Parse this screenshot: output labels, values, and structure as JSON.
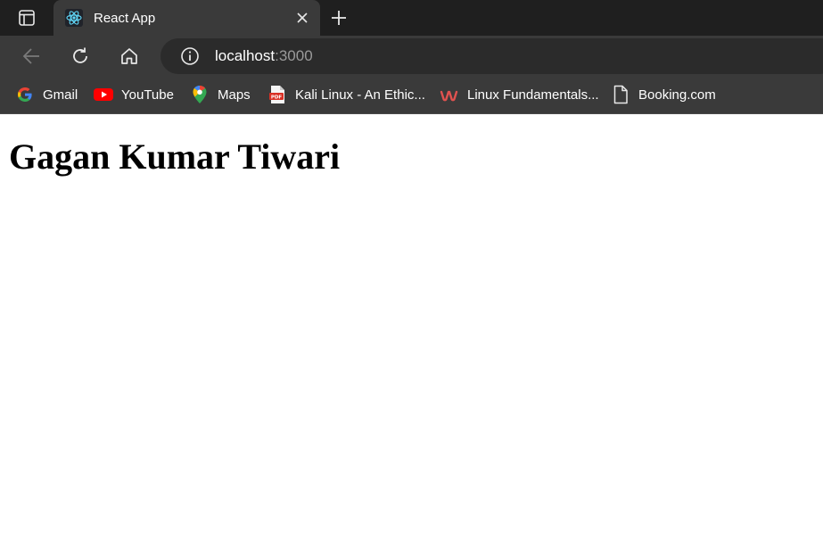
{
  "browser": {
    "tab": {
      "title": "React App",
      "favicon": "react-logo-icon"
    },
    "address_bar": {
      "host": "localhost",
      "port": ":3000"
    },
    "bookmarks": [
      {
        "label": "Gmail",
        "icon": "google-icon"
      },
      {
        "label": "YouTube",
        "icon": "youtube-icon"
      },
      {
        "label": "Maps",
        "icon": "maps-pin-icon"
      },
      {
        "label": "Kali Linux - An Ethic...",
        "icon": "pdf-icon"
      },
      {
        "label": "Linux Fundamentals...",
        "icon": "udemy-icon"
      },
      {
        "label": "Booking.com",
        "icon": "page-icon"
      }
    ],
    "colors": {
      "chrome_dark": "#1f1f1f",
      "toolbar": "#3a3a3a",
      "address_bar": "#2b2b2b",
      "react_blue": "#61dafb"
    }
  },
  "page": {
    "heading": "Gagan Kumar Tiwari"
  }
}
